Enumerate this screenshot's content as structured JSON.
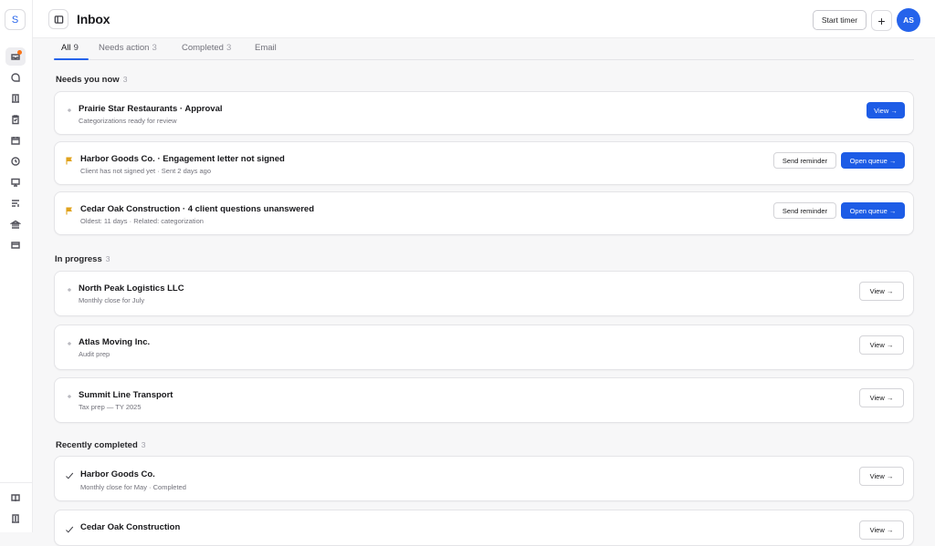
{
  "app": {
    "logo_letter": "S",
    "title": "Inbox"
  },
  "header": {
    "start_timer_label": "Start timer",
    "add_label": "+",
    "avatar_initials": "AS"
  },
  "tabs": [
    {
      "label": "All",
      "count": "9"
    },
    {
      "label": "Needs action",
      "count": "3"
    },
    {
      "label": "Completed",
      "count": "3"
    },
    {
      "label": "Email",
      "count": ""
    }
  ],
  "sections": {
    "needs": {
      "title": "Needs you now",
      "count": "3"
    },
    "progress": {
      "title": "In progress",
      "count": "3"
    },
    "completed": {
      "title": "Recently completed",
      "count": "3"
    }
  },
  "needs_items": [
    {
      "title": "Prairie Star Restaurants · Approval",
      "subtitle": "Categorizations ready for review",
      "icon": "sparkle-icon",
      "primary_label": "View →"
    },
    {
      "title": "Harbor Goods Co. · Engagement letter not signed",
      "subtitle": "Client has not signed yet · Sent 2 days ago",
      "icon": "flag-icon",
      "secondary_label": "Send reminder",
      "primary_label": "Open queue →"
    },
    {
      "title": "Cedar Oak Construction · 4 client questions unanswered",
      "subtitle": "Oldest: 11 days · Related: categorization",
      "icon": "flag-icon",
      "secondary_label": "Send reminder",
      "primary_label": "Open queue →"
    }
  ],
  "progress_items": [
    {
      "title": "North Peak Logistics LLC",
      "subtitle": "Monthly close for July",
      "icon": "sparkle-icon",
      "button_label": "View →"
    },
    {
      "title": "Atlas Moving Inc.",
      "subtitle": "Audit prep",
      "icon": "sparkle-icon",
      "button_label": "View →"
    },
    {
      "title": "Summit Line Transport",
      "subtitle": "Tax prep — TY 2025",
      "icon": "sparkle-icon",
      "button_label": "View →"
    }
  ],
  "completed_items": [
    {
      "title": "Harbor Goods Co.",
      "subtitle": "Monthly close for May · Completed",
      "icon": "check-icon",
      "button_label": "View →"
    },
    {
      "title": "Cedar Oak Construction",
      "subtitle": "",
      "icon": "check-icon",
      "button_label": "View →"
    }
  ],
  "colors": {
    "accent": "#1d5ce6",
    "flag": "#e0a21b",
    "notification_dot": "#f97316"
  }
}
